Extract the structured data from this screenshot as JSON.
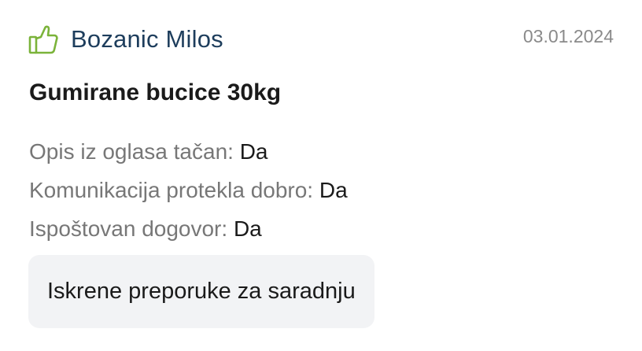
{
  "review": {
    "icon": "thumbs-up-icon",
    "icon_color": "#7bb33a",
    "author": "Bozanic Milos",
    "date": "03.01.2024",
    "title": "Gumirane bucice 30kg",
    "criteria": [
      {
        "label": "Opis iz oglasa tačan:",
        "value": "Da"
      },
      {
        "label": "Komunikacija protekla dobro:",
        "value": "Da"
      },
      {
        "label": "Ispoštovan dogovor:",
        "value": "Da"
      }
    ],
    "comment": "Iskrene preporuke za saradnju"
  }
}
